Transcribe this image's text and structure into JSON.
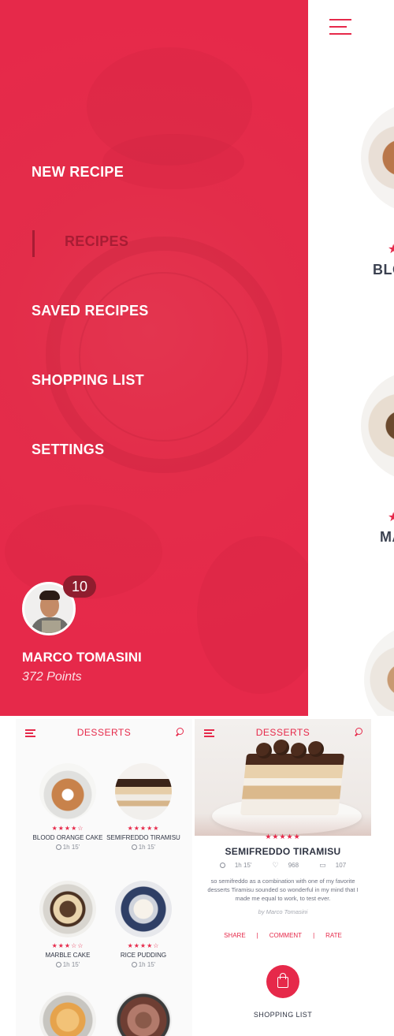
{
  "drawer": {
    "menu": [
      "NEW RECIPE",
      "RECIPES",
      "SAVED RECIPES",
      "SHOPPING LIST",
      "SETTINGS"
    ],
    "active_item": "RECIPES",
    "user": {
      "name": "MARCO TOMASINI",
      "points": "372 Points",
      "badge_count": "10"
    }
  },
  "behind": {
    "peek_text_1": "BLO",
    "peek_text_2": "MA"
  },
  "list_screen": {
    "title": "DESSERTS",
    "items": [
      {
        "name": "BLOOD ORANGE CAKE",
        "stars": "★★★★☆",
        "time": "1h 15'"
      },
      {
        "name": "SEMIFREDDO TIRAMISU",
        "stars": "★★★★★",
        "time": "1h 15'"
      },
      {
        "name": "MARBLE CAKE",
        "stars": "★★★☆☆",
        "time": "1h 15'"
      },
      {
        "name": "RICE PUDDING",
        "stars": "★★★★☆",
        "time": "1h 15'"
      }
    ]
  },
  "detail_screen": {
    "title": "DESSERTS",
    "stars": "★★★★★",
    "recipe_title": "SEMIFREDDO TIRAMISU",
    "time": "1h 15'",
    "likes": "968",
    "comments": "107",
    "description": "so semifreddo as a combination with one of my favorite desserts Tiramisu sounded so wonderful in my mind that I made me equal to work, to test ever.",
    "author": "by Marco Tomasini",
    "actions": [
      "SHARE",
      "COMMENT",
      "RATE"
    ],
    "cart_label": "SHOPPING LIST"
  },
  "colors": {
    "accent": "#e6294a",
    "dark_text": "#2e3342",
    "muted_text": "#8a8e98"
  },
  "icons": [
    "hamburger-icon",
    "search-icon",
    "clock-icon",
    "heart-icon",
    "comment-icon",
    "shopping-bag-icon",
    "star-icon"
  ]
}
